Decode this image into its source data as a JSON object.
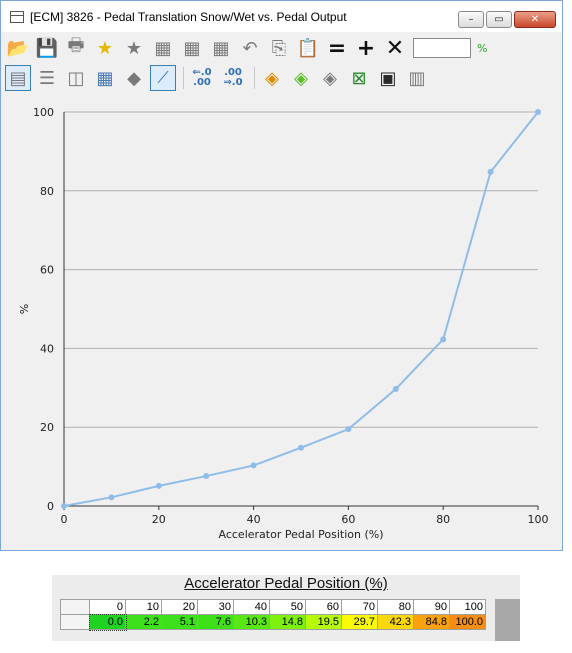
{
  "window": {
    "title": "[ECM] 3826 - Pedal Translation Snow/Wet vs. Pedal Output",
    "controls": {
      "minimize": "–",
      "maximize": "▭",
      "close": "✕"
    }
  },
  "toolbar": {
    "unit": "%",
    "input_value": "",
    "shift_left_top": "⇐.0",
    "shift_left_bottom": ".00",
    "shift_right_top": ".00",
    "shift_right_bottom": "⇒.0"
  },
  "chart_data": {
    "type": "line",
    "xlabel": "Accelerator Pedal Position (%)",
    "ylabel": "%",
    "xlim": [
      0,
      100
    ],
    "ylim": [
      0,
      100
    ],
    "xticks": [
      0,
      20,
      40,
      60,
      80,
      100
    ],
    "yticks": [
      0,
      20,
      40,
      60,
      80,
      100
    ],
    "grid": "horizontal",
    "line_color": "#8fbde8",
    "series": [
      {
        "x": [
          0,
          10,
          20,
          30,
          40,
          50,
          60,
          70,
          80,
          90,
          100
        ],
        "y": [
          0.0,
          2.2,
          5.1,
          7.6,
          10.3,
          14.8,
          19.5,
          29.7,
          42.3,
          84.8,
          100.0
        ]
      }
    ]
  },
  "table": {
    "title": "Accelerator Pedal Position (%)",
    "headers": [
      "0",
      "10",
      "20",
      "30",
      "40",
      "50",
      "60",
      "70",
      "80",
      "90",
      "100"
    ],
    "values": [
      "0.0",
      "2.2",
      "5.1",
      "7.6",
      "10.3",
      "14.8",
      "19.5",
      "29.7",
      "42.3",
      "84.8",
      "100.0"
    ],
    "cell_colors": [
      "#21d321",
      "#3ee01a",
      "#3ee01a",
      "#3ee01a",
      "#5ae814",
      "#7ef010",
      "#b6f90a",
      "#fbfb09",
      "#fbd80b",
      "#f9a20f",
      "#f68d14"
    ]
  }
}
